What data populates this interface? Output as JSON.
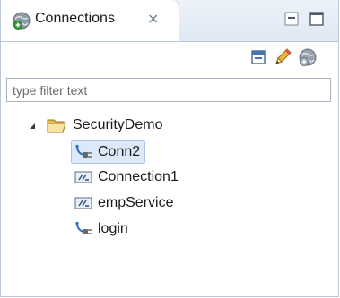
{
  "view": {
    "tab_title": "Connections",
    "close_glyph": "⨯",
    "icons": {
      "tab": "globe-connections-icon",
      "minimize": "minimize-icon",
      "maximize": "maximize-icon",
      "collapse_all": "collapse-all-icon",
      "edit": "pencil-icon",
      "new_connection": "globe-add-icon"
    }
  },
  "filter": {
    "placeholder": "type filter text",
    "value": ""
  },
  "tree": {
    "root": {
      "label": "SecurityDemo",
      "expanded": true,
      "icon": "folder-open-icon"
    },
    "children": [
      {
        "label": "Conn2",
        "icon": "plug-connection-icon",
        "selected": true
      },
      {
        "label": "Connection1",
        "icon": "db-connection-icon",
        "selected": false
      },
      {
        "label": "empService",
        "icon": "db-connection-icon",
        "selected": false
      },
      {
        "label": "login",
        "icon": "plug-connection-icon",
        "selected": false
      }
    ]
  },
  "colors": {
    "selection": "#dbe9f8",
    "selection_border": "#a8c6e8",
    "frame": "#b9c7d8"
  }
}
